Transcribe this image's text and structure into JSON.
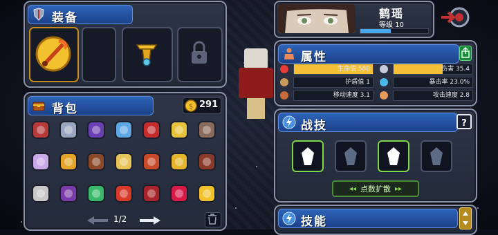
{
  "equipment": {
    "title": "装备",
    "weapon_icon": "flame-sword-icon",
    "accessory_icon": "gold-amulet-icon",
    "locked_icon": "padlock-icon"
  },
  "backpack": {
    "title": "背包",
    "coins": "291",
    "coin_icon": "gold-coin-icon",
    "page": "1/2",
    "items": [
      "red-potion-card-icon",
      "robot-card-icon",
      "purple-eye-orb-icon",
      "magnifier-staff-icon",
      "red-book-icon",
      "yellow-star-charm-icon",
      "drum-set-icon",
      "spiked-ring-icon",
      "golden-wing-icon",
      "horse-mask-icon",
      "yellow-jar-icon",
      "red-gear-icon",
      "yellow-cannon-icon",
      "bead-necklace-icon",
      "scythe-icon",
      "purple-demon-icon",
      "green-orb-icon",
      "red-goggles-icon",
      "monster-jaw-icon",
      "red-ball-icon",
      "golden-claw-icon"
    ]
  },
  "character": {
    "name": "鹤瑶",
    "level_label": "等级 10",
    "exp_fraction": 0.45
  },
  "attributes": {
    "title": "属性",
    "stats": [
      {
        "label": "生命值 588",
        "fill": 1.0,
        "icon": "heart-icon",
        "color": "#f4c038"
      },
      {
        "label": "伤害 35.4",
        "fill": 0.62,
        "icon": "sword-icon",
        "color": "#f4c038"
      },
      {
        "label": "护盾值 1",
        "fill": 0.0,
        "icon": "shield-icon",
        "color": "#f4c038"
      },
      {
        "label": "暴击率 23.0%",
        "fill": 0.0,
        "icon": "eye-icon",
        "color": "#f4c038"
      },
      {
        "label": "移动速度 3.1",
        "fill": 0.0,
        "icon": "boot-icon",
        "color": "#f4c038"
      },
      {
        "label": "攻击速度 2.8",
        "fill": 0.0,
        "icon": "fist-icon",
        "color": "#f4c038"
      }
    ]
  },
  "combat_skills": {
    "title": "战技",
    "help": "?",
    "expand_label": "点数扩散",
    "skills": [
      "muscle-body-icon",
      "slash-icon",
      "phoenix-icon",
      "vortex-icon"
    ]
  },
  "abilities": {
    "title": "技能"
  }
}
